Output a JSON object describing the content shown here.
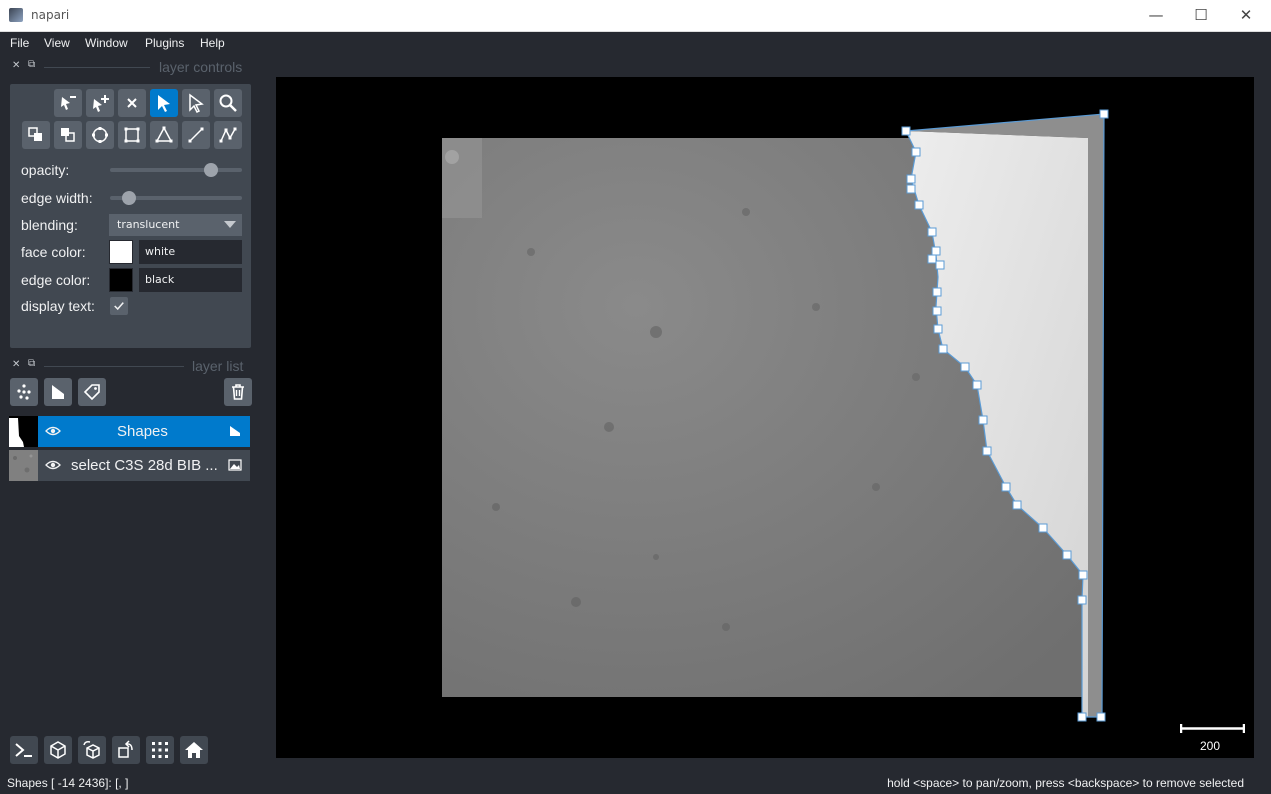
{
  "window": {
    "title": "napari",
    "minimize": "—",
    "maximize": "☐",
    "close": "✕"
  },
  "menu": [
    "File",
    "View",
    "Window",
    "Plugins",
    "Help"
  ],
  "layer_controls": {
    "dock_title": "layer controls",
    "opacity_label": "opacity:",
    "opacity_value": 0.8,
    "edge_width_label": "edge width:",
    "edge_width_value": 0.1,
    "blending_label": "blending:",
    "blending_value": "translucent",
    "face_color_label": "face color:",
    "face_color_name": "white",
    "face_color": "#ffffff",
    "edge_color_label": "edge color:",
    "edge_color_name": "black",
    "edge_color": "#000000",
    "display_text_label": "display text:",
    "display_text_checked": true,
    "active_tool": "select-shapes"
  },
  "layer_list": {
    "dock_title": "layer list",
    "layers": [
      {
        "name": "Shapes",
        "selected": true,
        "visible": true,
        "type": "shapes"
      },
      {
        "name": "select C3S 28d BIB ...",
        "selected": false,
        "visible": true,
        "type": "image"
      }
    ]
  },
  "canvas": {
    "scale_bar_label": "200",
    "background": "#000000"
  },
  "status": {
    "left": "Shapes [ -14 2436]: [, ]",
    "right": "hold <space> to pan/zoom, press <backspace> to remove selected"
  },
  "colors": {
    "accent": "#007acc",
    "panel": "#414851",
    "background": "#262930",
    "button": "#5a626c"
  }
}
